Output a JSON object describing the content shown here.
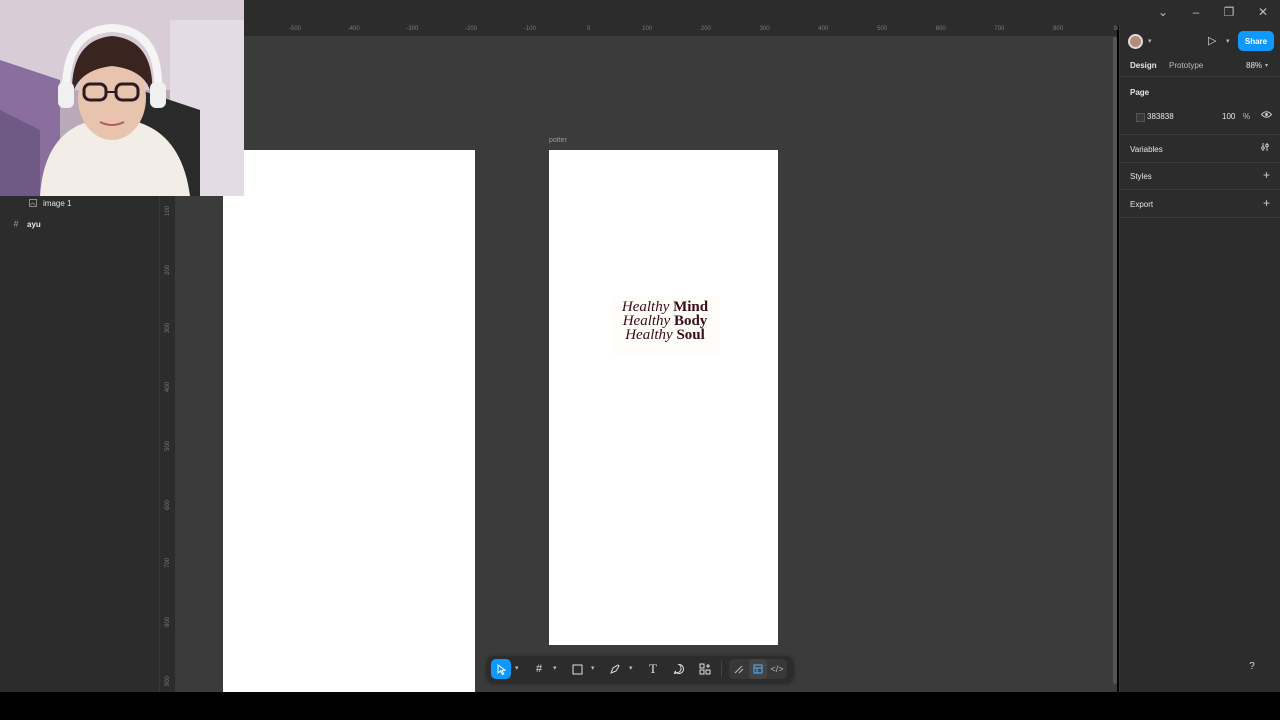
{
  "window": {
    "controls": [
      "chevron-down-icon",
      "minimize-icon",
      "restore-icon",
      "close-icon"
    ]
  },
  "rulers": {
    "horizontal": [
      "-500",
      "-400",
      "-300",
      "-200",
      "-100",
      "0",
      "100",
      "200",
      "300",
      "400",
      "500",
      "600",
      "700",
      "800",
      "90"
    ],
    "vertical": [
      "100",
      "200",
      "300",
      "400",
      "500",
      "600",
      "700",
      "800",
      "900"
    ]
  },
  "layers": {
    "items": [
      {
        "label": "image 1",
        "icon": "image-icon"
      },
      {
        "label": "ayu",
        "icon": "frame-icon"
      }
    ]
  },
  "canvas": {
    "frame_label": "potter",
    "tagline": [
      {
        "italic": "Healthy",
        "bold": "Mind"
      },
      {
        "italic": "Healthy",
        "bold": "Body"
      },
      {
        "italic": "Healthy",
        "bold": "Soul"
      }
    ]
  },
  "toolbar": {
    "tools": [
      "move-tool-icon",
      "frame-tool-icon",
      "rectangle-tool-icon",
      "pen-tool-icon",
      "text-tool-icon",
      "comment-tool-icon",
      "actions-tool-icon"
    ],
    "modes": [
      "draw-mode-icon",
      "design-mode-icon",
      "dev-mode-icon"
    ]
  },
  "properties": {
    "share_label": "Share",
    "tabs": {
      "design": "Design",
      "prototype": "Prototype"
    },
    "zoom": "88%",
    "page_heading": "Page",
    "page_color": "383838",
    "page_opacity": "100",
    "percent_sign": "%",
    "variables_label": "Variables",
    "styles_label": "Styles",
    "export_label": "Export"
  },
  "help_label": "?",
  "colors": {
    "accent": "#0d99ff",
    "canvas_bg": "#3b3b3b",
    "panel_bg": "#2c2c2c",
    "tagline_text": "#3a0d12"
  }
}
